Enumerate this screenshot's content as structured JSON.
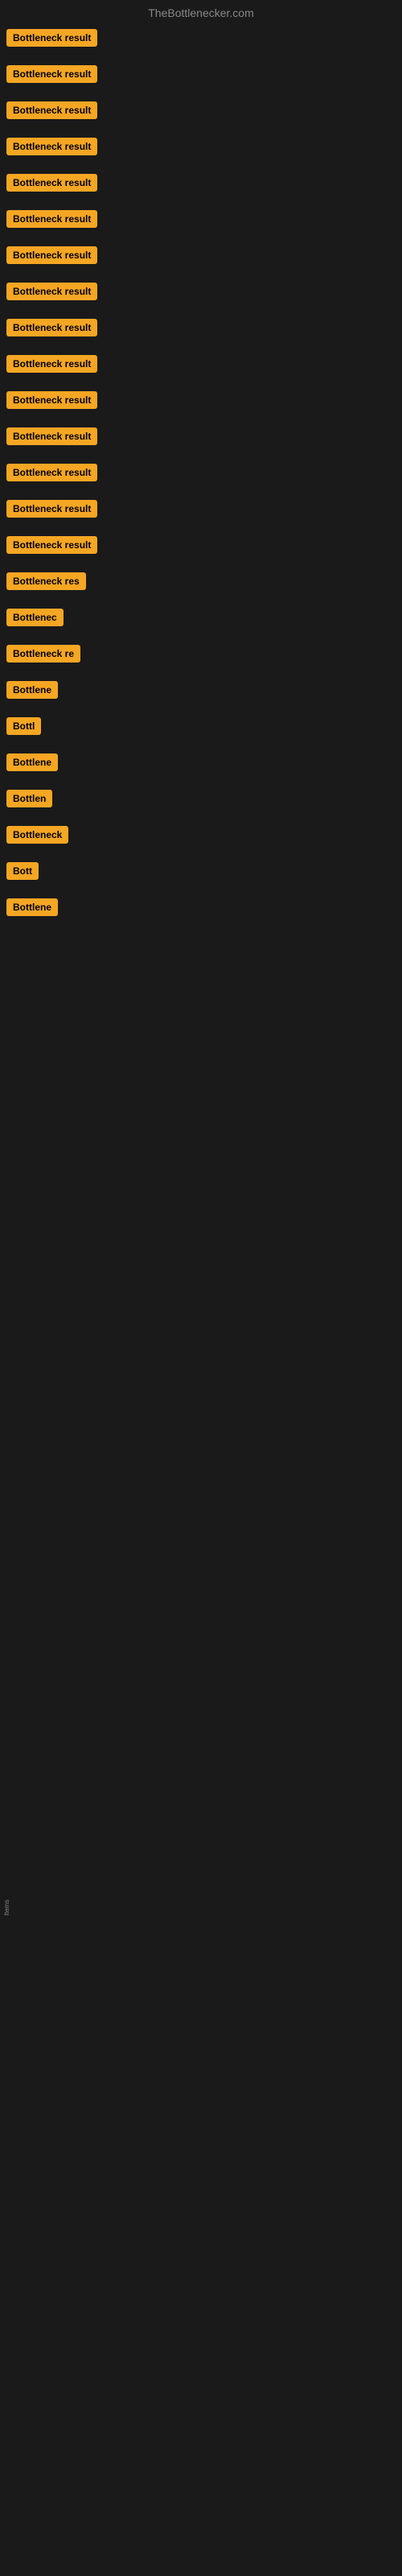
{
  "site": {
    "title": "TheBottlenecker.com"
  },
  "items": [
    {
      "id": 1,
      "label": "Bottleneck result",
      "width": 130
    },
    {
      "id": 2,
      "label": "Bottleneck result",
      "width": 130
    },
    {
      "id": 3,
      "label": "Bottleneck result",
      "width": 130
    },
    {
      "id": 4,
      "label": "Bottleneck result",
      "width": 130
    },
    {
      "id": 5,
      "label": "Bottleneck result",
      "width": 130
    },
    {
      "id": 6,
      "label": "Bottleneck result",
      "width": 130
    },
    {
      "id": 7,
      "label": "Bottleneck result",
      "width": 130
    },
    {
      "id": 8,
      "label": "Bottleneck result",
      "width": 130
    },
    {
      "id": 9,
      "label": "Bottleneck result",
      "width": 130
    },
    {
      "id": 10,
      "label": "Bottleneck result",
      "width": 130
    },
    {
      "id": 11,
      "label": "Bottleneck result",
      "width": 130
    },
    {
      "id": 12,
      "label": "Bottleneck result",
      "width": 130
    },
    {
      "id": 13,
      "label": "Bottleneck result",
      "width": 130
    },
    {
      "id": 14,
      "label": "Bottleneck result",
      "width": 130
    },
    {
      "id": 15,
      "label": "Bottleneck result",
      "width": 130
    },
    {
      "id": 16,
      "label": "Bottleneck res",
      "width": 110
    },
    {
      "id": 17,
      "label": "Bottlenec",
      "width": 82
    },
    {
      "id": 18,
      "label": "Bottleneck re",
      "width": 100
    },
    {
      "id": 19,
      "label": "Bottlene",
      "width": 76
    },
    {
      "id": 20,
      "label": "Bottl",
      "width": 52
    },
    {
      "id": 21,
      "label": "Bottlene",
      "width": 76
    },
    {
      "id": 22,
      "label": "Bottlen",
      "width": 68
    },
    {
      "id": 23,
      "label": "Bottleneck",
      "width": 86
    },
    {
      "id": 24,
      "label": "Bott",
      "width": 44
    },
    {
      "id": 25,
      "label": "Bottlene",
      "width": 76
    }
  ],
  "bottom_label": "Items"
}
